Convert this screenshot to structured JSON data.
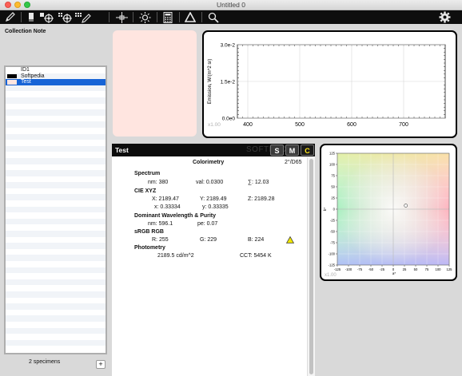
{
  "window": {
    "title": "Untitled 0"
  },
  "toolbar": {
    "icons": [
      "pencil-icon",
      "measure-icon",
      "target-measure-icon",
      "target-grid-icon",
      "grid-pencil-icon",
      "crosshair-icon",
      "sun-icon",
      "calculator-icon",
      "delta-icon",
      "search-icon",
      "gear-icon"
    ]
  },
  "collection": {
    "note_label": "Collection Note",
    "specimens": [
      {
        "name": "ID1",
        "swatch": "#ffffff"
      },
      {
        "name": "Softpedia",
        "swatch": "#000000"
      },
      {
        "name": "Test",
        "swatch": "#ffe5e0",
        "selected": true
      }
    ],
    "count_text": "2 specimens",
    "add_label": "+"
  },
  "preview": {
    "color": "#ffe5e0"
  },
  "emission_chart": {
    "watermark": "x1.00",
    "chart_data": {
      "type": "line",
      "title": "",
      "xlabel": "",
      "ylabel": "Emission, W/(m^2 sr)",
      "x_ticks": [
        "400",
        "500",
        "600",
        "700"
      ],
      "y_ticks": [
        "0.0e0",
        "1.5e-2",
        "3.0e-2"
      ],
      "xlim": [
        380,
        780
      ],
      "ylim": [
        0,
        0.03
      ],
      "grid": true,
      "series": []
    }
  },
  "sample": {
    "title": "Test",
    "watermark": "SOFTPEDIA",
    "modes": [
      "S",
      "M",
      "C"
    ],
    "active_mode": "C"
  },
  "colorimetry": {
    "title": "Colorimetry",
    "illuminant": "2°/D65",
    "spectrum": {
      "label": "Spectrum",
      "nm": "nm: 380",
      "val": "val: 0.0300",
      "sum": "∑: 12.03"
    },
    "xyz": {
      "label": "CIE XYZ",
      "X": "X: 2189.47",
      "Y": "Y: 2189.49",
      "Z": "Z: 2189.28",
      "x": "x: 0.33334",
      "y": "y: 0.33335"
    },
    "dominant": {
      "label": "Dominant Wavelength & Purity",
      "nm": "nm: 596.1",
      "pe": "pe: 0.07"
    },
    "srgb": {
      "label": "sRGB RGB",
      "R": "R: 255",
      "G": "G: 229",
      "B": "B: 224"
    },
    "photometry": {
      "label": "Photometry",
      "lum": "2189.5 cd/m^2",
      "cct": "CCT: 5454 K"
    }
  },
  "ab_chart": {
    "watermark": "x1.00",
    "chart_data": {
      "type": "scatter",
      "title": "",
      "xlabel": "a*",
      "ylabel": "b*",
      "xlim": [
        -125,
        125
      ],
      "ylim": [
        -125,
        125
      ],
      "x_ticks": [
        "-125",
        "-100",
        "-75",
        "-50",
        "-25",
        "0",
        "25",
        "50",
        "75",
        "100",
        "125"
      ],
      "y_ticks": [
        "125",
        "100",
        "75",
        "50",
        "25",
        "0",
        "-25",
        "-50",
        "-75",
        "-100",
        "-125"
      ],
      "grid": true,
      "points": [
        {
          "a": 28,
          "b": 8
        }
      ]
    }
  }
}
